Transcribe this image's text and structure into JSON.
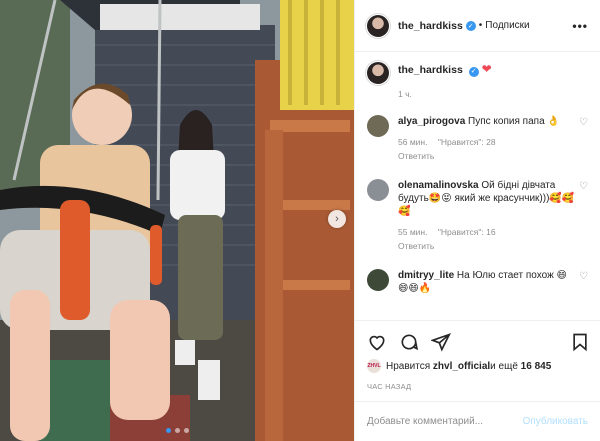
{
  "header": {
    "username": "the_hardkiss",
    "separator": "•",
    "follow_label": "Подписки",
    "more": "•••"
  },
  "caption": {
    "username": "the_hardkiss",
    "text": "❤",
    "time": "1 ч."
  },
  "comments": [
    {
      "username": "alya_pirogova",
      "text": "Пупс копия папа 👌",
      "time": "56 мин.",
      "likes": "\"Нравится\": 28",
      "reply": "Ответить",
      "avatar_color": "#6e6a55"
    },
    {
      "username": "olenamalinovska",
      "text": "Ой бідні дівчата будуть🤩😝 який же красунчик)))🥰🥰🥰",
      "time": "55 мин.",
      "likes": "\"Нравится\": 16",
      "reply": "Ответить",
      "avatar_color": "#8a8f95"
    },
    {
      "username": "dmitryy_lite",
      "text": "На Юлю стает похож 😄😄😄🔥",
      "time": "",
      "likes": "",
      "reply": "",
      "avatar_color": "#3e4a37"
    }
  ],
  "likes": {
    "avatar_text": "ZHVL",
    "prefix": "Нравится ",
    "user": "zhvl_official",
    "middle": " и ещё ",
    "count": "16 845"
  },
  "posted_ago": "ЧАС НАЗАД",
  "add_comment": {
    "placeholder": "Добавьте комментарий...",
    "publish": "Опубликовать"
  },
  "icons": [
    "heart-icon",
    "comment-icon",
    "share-icon",
    "bookmark-icon",
    "chevron-right-icon",
    "verified-icon"
  ],
  "colors": {
    "verified": "#3897f0",
    "heart": "#ed4956",
    "publish_disabled": "#b2dffc"
  }
}
